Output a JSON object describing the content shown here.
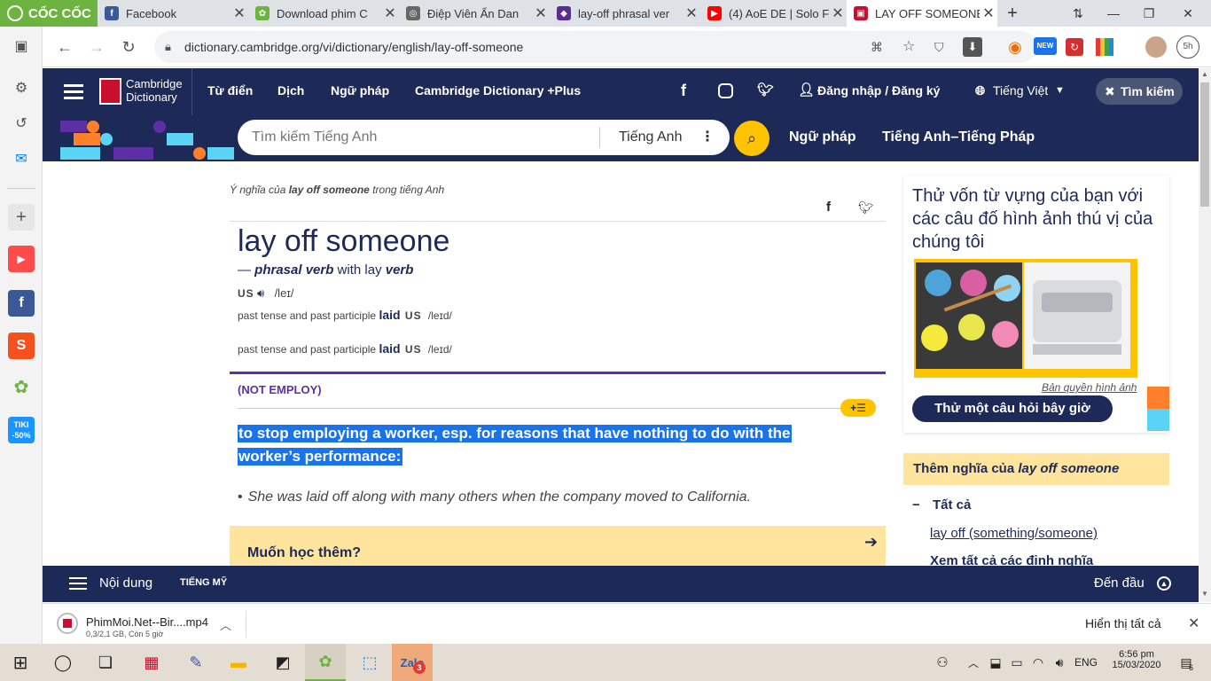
{
  "browser": {
    "brand": "CỐC CỐC",
    "tabs": [
      {
        "title": "Facebook",
        "fav_color": "#3b5998",
        "fav_char": "f"
      },
      {
        "title": "Download phim C",
        "fav_color": "#6cb33f",
        "fav_char": "✿"
      },
      {
        "title": "Điệp Viên Ẩn Dan",
        "fav_color": "#666666",
        "fav_char": "◎"
      },
      {
        "title": "lay-off phrasal ver",
        "fav_color": "#5c2d91",
        "fav_char": "◆"
      },
      {
        "title": "(4) AoE DE | Solo F",
        "fav_color": "#ff0000",
        "fav_char": "▶"
      },
      {
        "title": "LAY OFF SOMEONE",
        "fav_color": "#c8102e",
        "fav_char": "▣"
      }
    ],
    "url": "dictionary.cambridge.org/vi/dictionary/english/lay-off-someone",
    "profile_time": "5h"
  },
  "site": {
    "logo_line1": "Cambridge",
    "logo_line2": "Dictionary",
    "nav": [
      "Từ điển",
      "Dịch",
      "Ngữ pháp",
      "Cambridge Dictionary +Plus"
    ],
    "login": "Đăng nhập / Đăng ký",
    "language": "Tiếng Việt",
    "search_btn": "Tìm kiếm",
    "search_placeholder": "Tìm kiếm Tiếng Anh",
    "search_lang": "Tiếng Anh",
    "sub_nav": [
      "Ngữ pháp",
      "Tiếng Anh–Tiếng Pháp"
    ]
  },
  "entry": {
    "meaning_prefix": "Ý nghĩa của ",
    "meaning_word": "lay off someone",
    "meaning_suffix": " trong tiếng Anh",
    "headword": "lay off someone",
    "pos_dash": "— ",
    "pos": "phrasal verb",
    "with_text": " with lay ",
    "with_pos": "verb",
    "us_label": "US",
    "ipa": "/leɪ/",
    "forms": [
      {
        "label": "past tense and past participle ",
        "word": "laid",
        "region": "US",
        "ipa": "/leɪd/"
      },
      {
        "label": "past tense and past participle ",
        "word": "laid",
        "region": "US",
        "ipa": "/leɪd/"
      }
    ],
    "guideword": "(NOT EMPLOY)",
    "definition_line1": "to stop employing a worker, esp. for reasons that have nothing to do with the",
    "definition_line2": "worker’s performance:",
    "example": "She was laid off along with many others when the company moved to California.",
    "learn_more": "Muốn học thêm?"
  },
  "sidebar": {
    "promo_title": "Thử vốn từ vựng của bạn với các câu đố hình ảnh thú vị của chúng tôi",
    "copyright": "Bản quyền hình ảnh",
    "quiz_btn": "Thử một câu hỏi bây giờ",
    "more_meanings_prefix": "Thêm nghĩa của ",
    "more_meanings_word": "lay off someone",
    "all_label": "Tất cả",
    "link": "lay off (something/someone)",
    "see_all": "Xem tất cả các định nghĩa"
  },
  "bottom": {
    "contents": "Nội dung",
    "region": "TIẾNG MỸ",
    "to_top": "Đến đầu"
  },
  "download": {
    "filename": "PhimMoi.Net--Bir....mp4",
    "status": "0,3/2,1 GB, Còn 5 giờ",
    "show_all": "Hiển thị tất cả"
  },
  "taskbar": {
    "lang": "ENG",
    "time": "6:56 pm",
    "date": "15/03/2020",
    "notif_count": "6",
    "zalo_badge": "3"
  },
  "colors": {
    "navy": "#1d2a57",
    "yellow": "#fee49d",
    "highlight": "#1a73e8",
    "purple": "#5d2fa7",
    "gold": "#ffc300"
  }
}
